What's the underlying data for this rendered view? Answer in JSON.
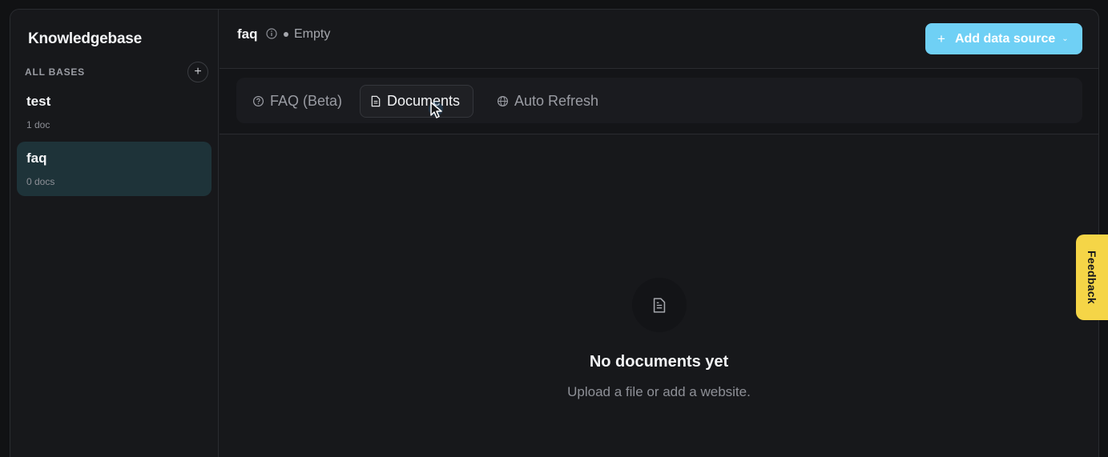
{
  "sidebar": {
    "title": "Knowledgebase",
    "section_label": "ALL BASES",
    "add_icon": "+",
    "items": [
      {
        "name": "test",
        "count": "1 doc",
        "active": false
      },
      {
        "name": "faq",
        "count": "0 docs",
        "active": true
      }
    ]
  },
  "header": {
    "title": "faq",
    "status": "Empty",
    "add_button": {
      "icon": "+",
      "label": "Add data source"
    }
  },
  "tabs": [
    {
      "label": "FAQ (Beta)",
      "icon": "faq-bubble-icon",
      "active": false
    },
    {
      "label": "Documents",
      "icon": "document-icon",
      "active": true
    },
    {
      "label": "Auto Refresh",
      "icon": "globe-icon",
      "active": false
    }
  ],
  "empty_state": {
    "title": "No documents yet",
    "subtitle": "Upload a file or add a website."
  },
  "feedback": {
    "label": "Feedback"
  },
  "colors": {
    "accent": "#6fd0f5",
    "active_item": "#1e3339",
    "feedback": "#f5d547"
  }
}
